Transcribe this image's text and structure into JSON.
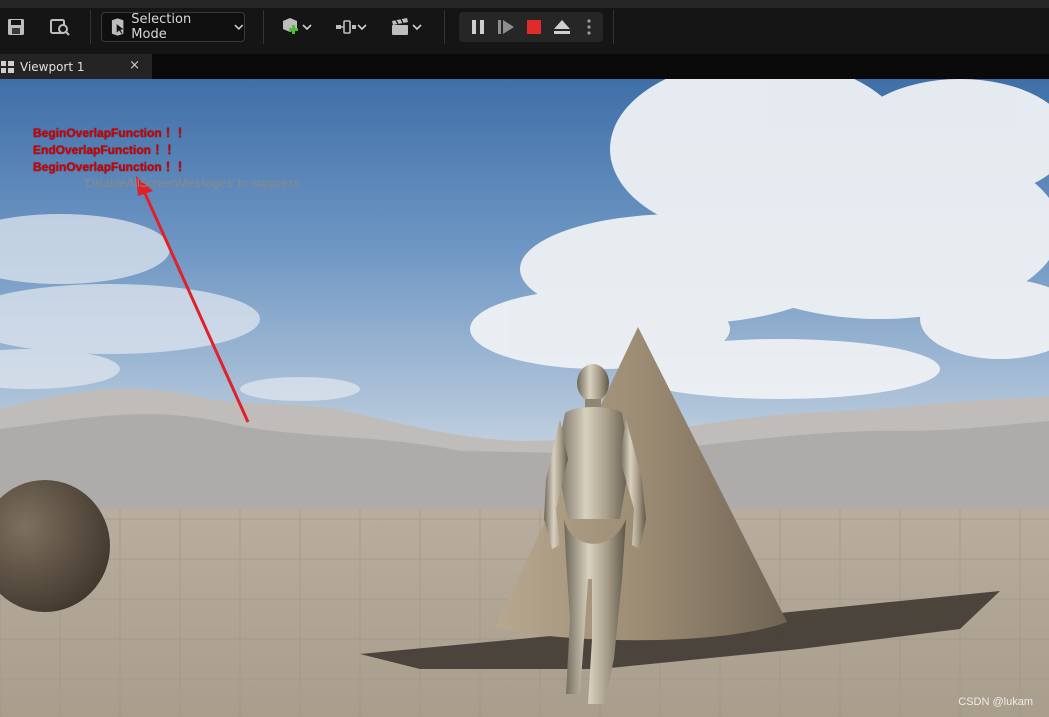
{
  "toolbar": {
    "selection_mode_label": "Selection Mode"
  },
  "tabs": [
    {
      "label": "Viewport 1",
      "close": "×"
    }
  ],
  "viewport": {
    "messages": [
      "BeginOverlapFunction ！！",
      "EndOverlapFunction ！！",
      "BeginOverlapFunction ！！"
    ],
    "hint": "'DisableAllScreenMessages' to suppress",
    "watermark": "CSDN @lukam"
  },
  "colors": {
    "message_red": "#d10000",
    "stop_red": "#e02b2b",
    "annotation_arrow": "#e0202a",
    "add_green": "#4fbf3a"
  }
}
